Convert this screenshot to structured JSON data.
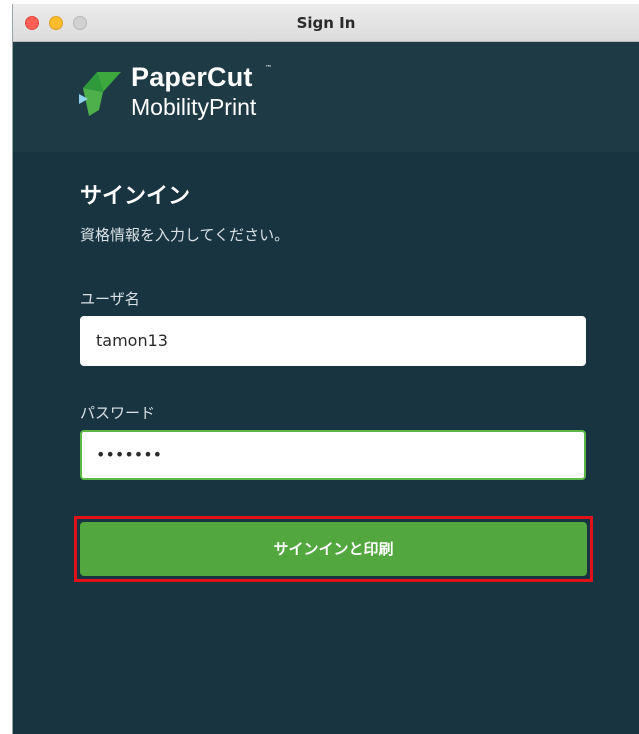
{
  "window": {
    "title": "Sign In"
  },
  "logo": {
    "brand": "PaperCut",
    "trademark": "™",
    "product": "MobilityPrint"
  },
  "form": {
    "heading": "サインイン",
    "subtext": "資格情報を入力してください。",
    "username_label": "ユーザ名",
    "username_value": "tamon13",
    "password_label": "パスワード",
    "password_value": "•••••••",
    "submit_label": "サインインと印刷"
  },
  "colors": {
    "background": "#183440",
    "header": "#1d3a45",
    "button": "#52a83e",
    "focus_border": "#5bb847",
    "highlight": "#e01219"
  },
  "icons": {
    "logo": "papercut-logo-icon"
  }
}
